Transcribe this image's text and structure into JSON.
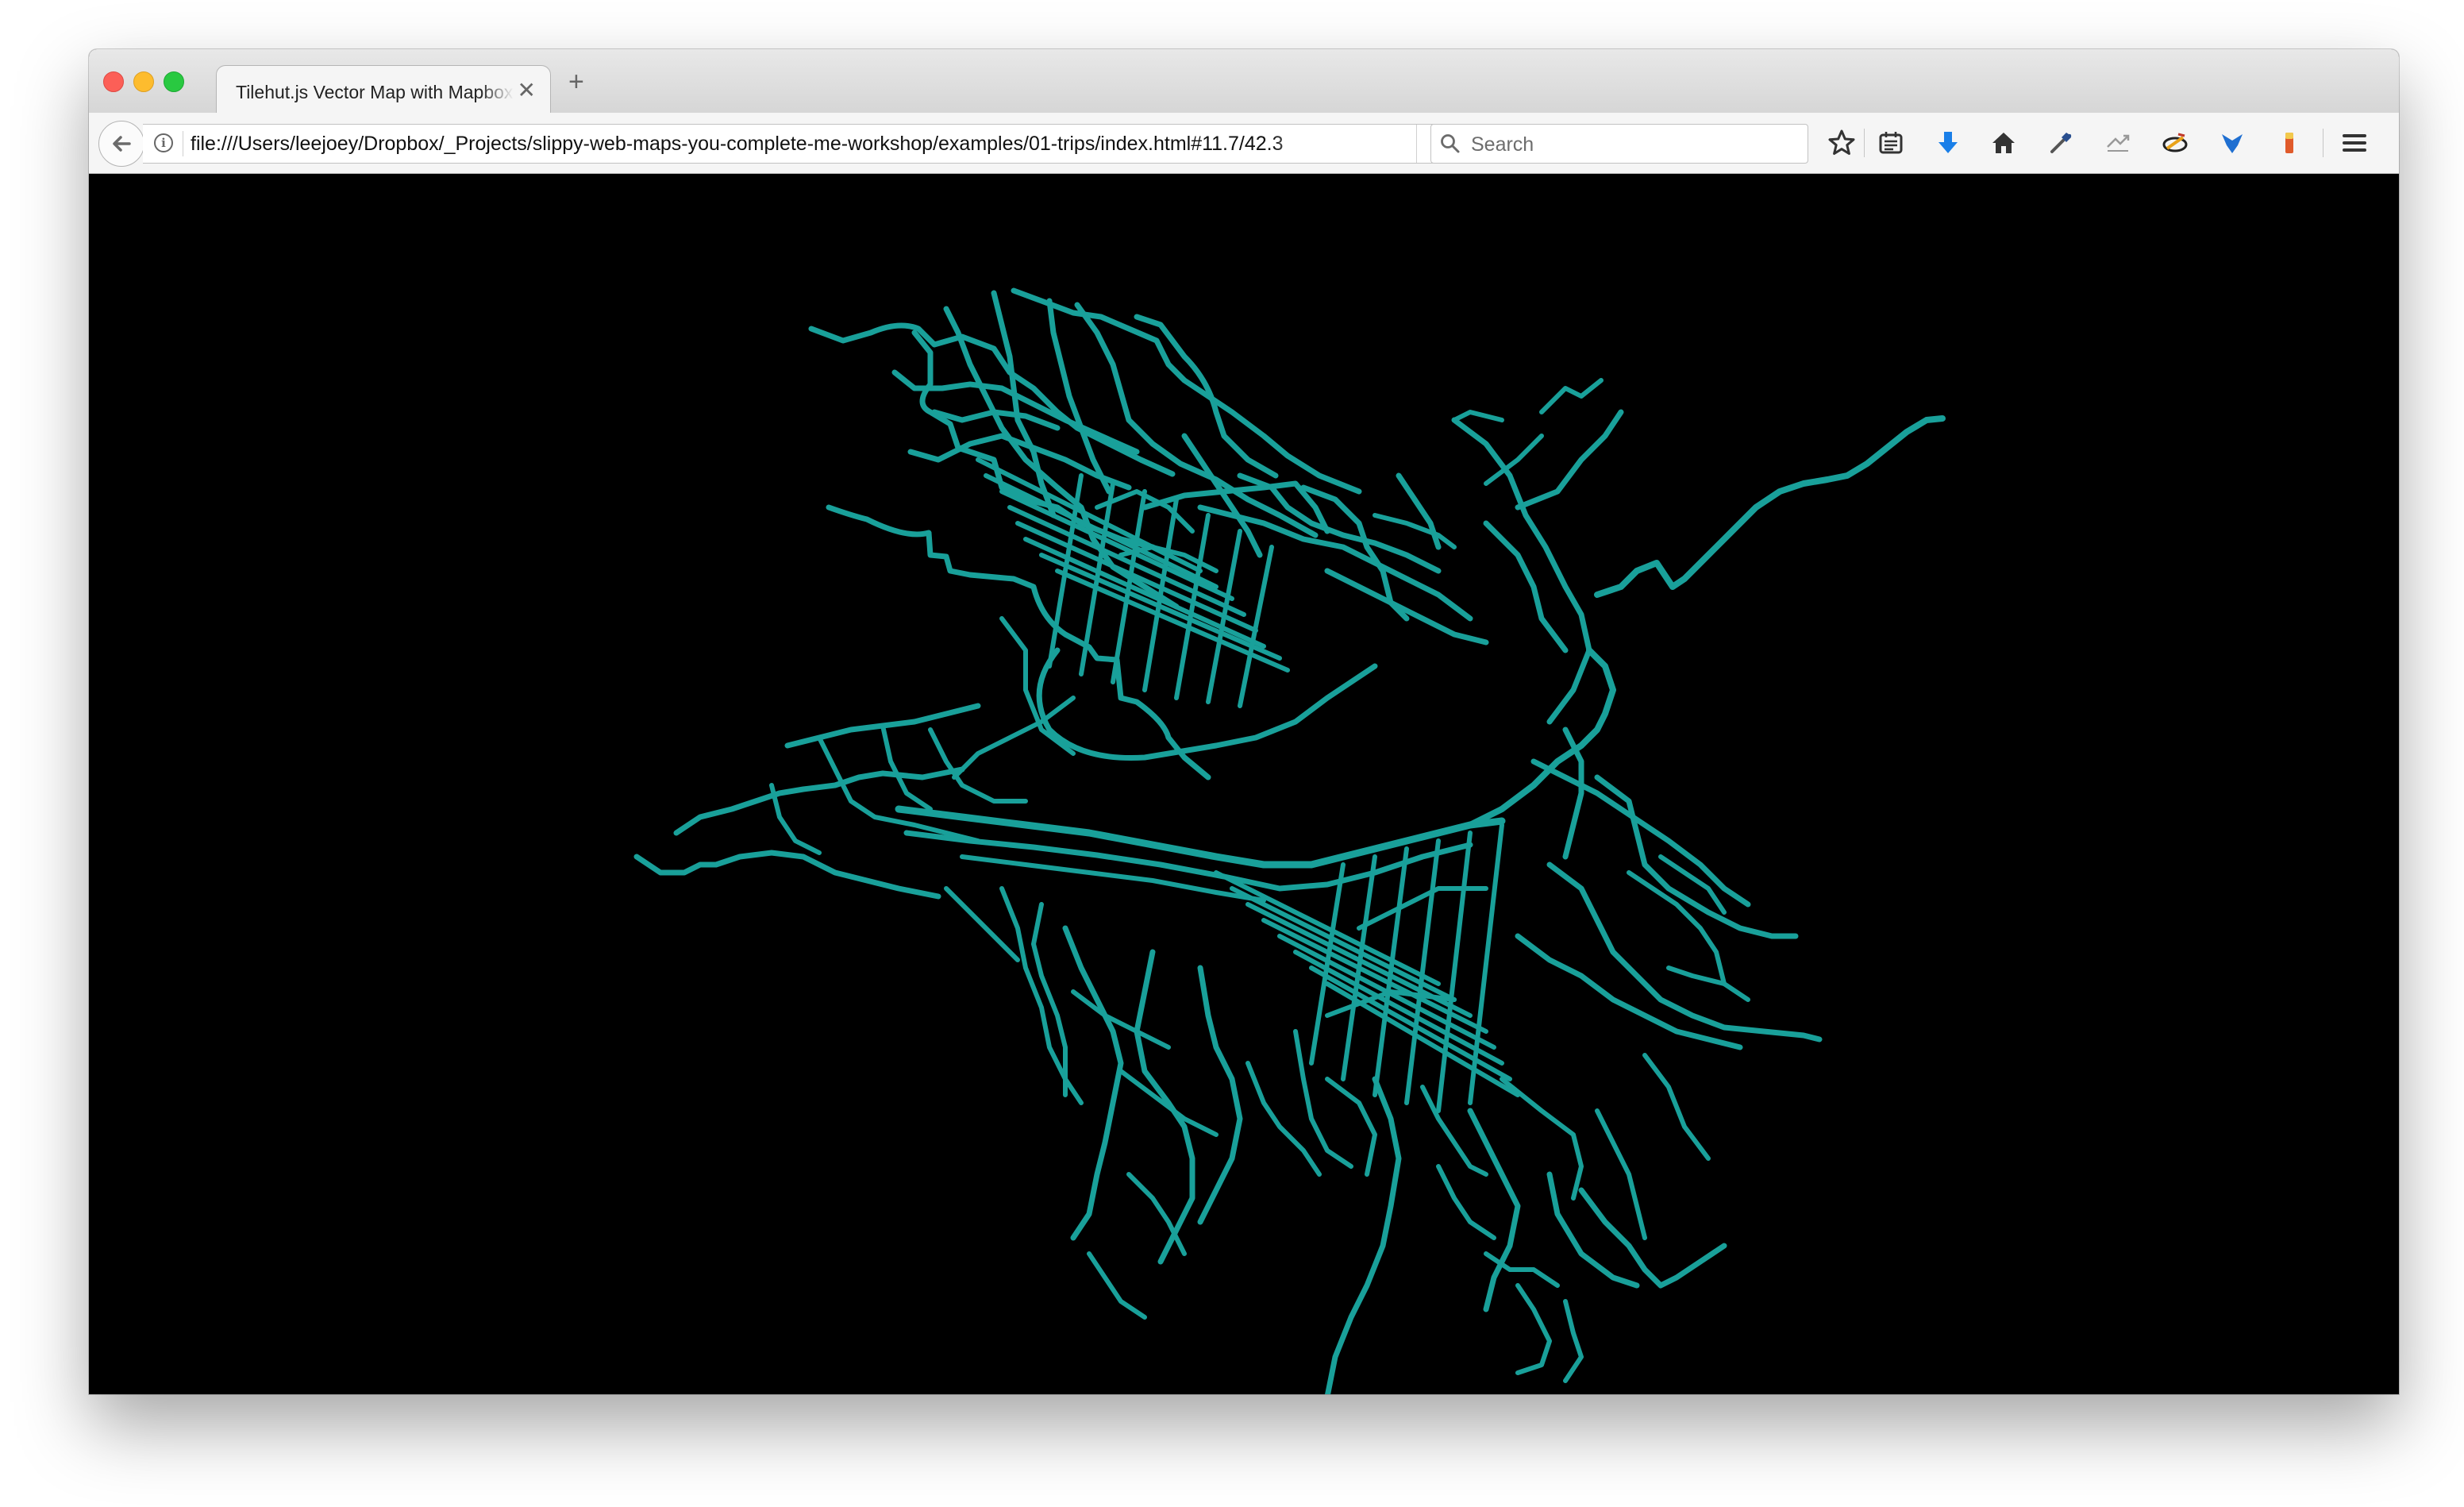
{
  "browser": {
    "tab_title": "Tilehut.js Vector Map with Mapbox GL",
    "close_glyph": "✕",
    "new_tab_glyph": "+",
    "url": "file:///Users/leejoey/Dropbox/_Projects/slippy-web-maps-you-complete-me-workshop/examples/01-trips/index.html#11.7/42.3",
    "search_placeholder": "Search",
    "toolbar_icons": [
      "star-icon",
      "reading-list-icon",
      "download-icon",
      "home-icon",
      "eyedropper-icon",
      "sync-icon",
      "extension-icon",
      "shield-icon",
      "battery-icon",
      "menu-icon"
    ]
  },
  "map": {
    "background": "#000000",
    "route_color": "#19a09a",
    "layer": "trips"
  }
}
